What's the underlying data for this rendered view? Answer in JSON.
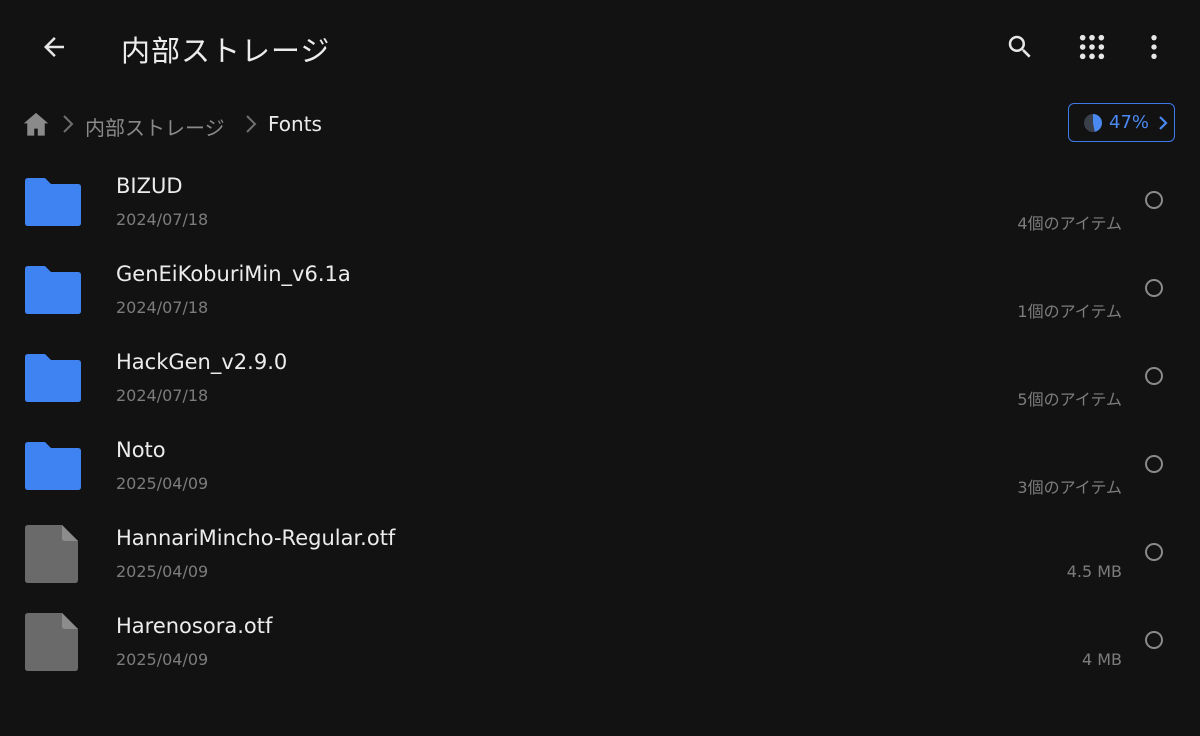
{
  "appbar": {
    "title": "内部ストレージ",
    "back_icon": "arrow-back-icon",
    "actions": [
      "search-icon",
      "grid-view-icon",
      "more-vert-icon"
    ]
  },
  "breadcrumb": {
    "home_icon": "home-icon",
    "items": [
      "内部ストレージ",
      "Fonts"
    ]
  },
  "storage": {
    "percent_label": "47%",
    "used_fraction": 0.47,
    "accent_color": "#3d7ae8"
  },
  "files": [
    {
      "name": "BIZUD",
      "date": "2024/07/18",
      "meta": "4個のアイテム",
      "type": "folder"
    },
    {
      "name": "GenEiKoburiMin_v6.1a",
      "date": "2024/07/18",
      "meta": "1個のアイテム",
      "type": "folder"
    },
    {
      "name": "HackGen_v2.9.0",
      "date": "2024/07/18",
      "meta": "5個のアイテム",
      "type": "folder"
    },
    {
      "name": "Noto",
      "date": "2025/04/09",
      "meta": "3個のアイテム",
      "type": "folder"
    },
    {
      "name": "HannariMincho-Regular.otf",
      "date": "2025/04/09",
      "meta": "4.5 MB",
      "type": "file"
    },
    {
      "name": "Harenosora.otf",
      "date": "2025/04/09",
      "meta": "4 MB",
      "type": "file"
    }
  ],
  "colors": {
    "background": "#121212",
    "folder": "#3f82f2",
    "file": "#6a6a6a"
  }
}
